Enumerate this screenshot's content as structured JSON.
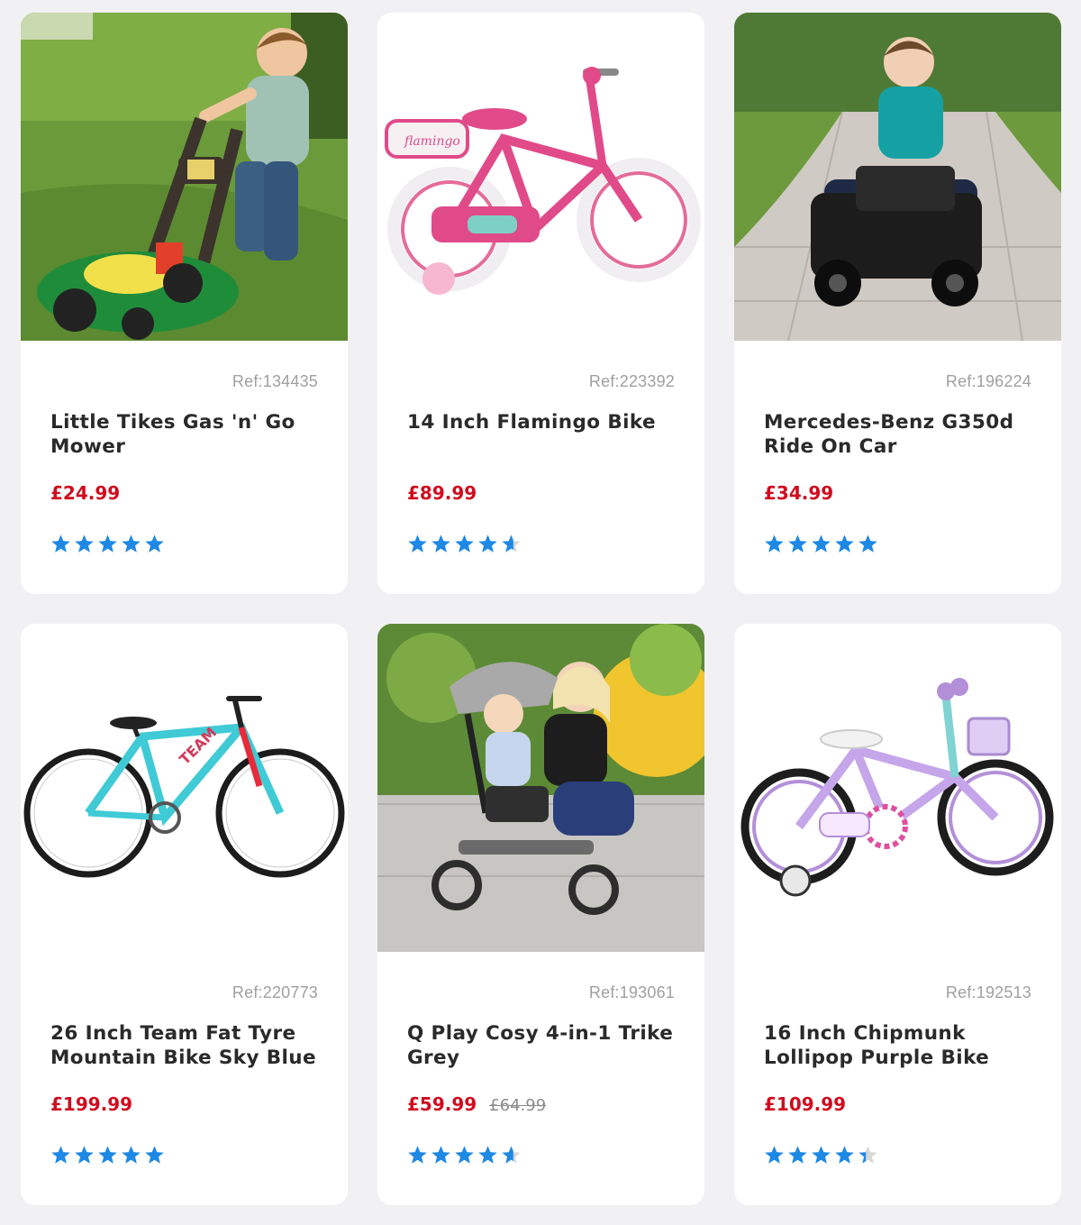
{
  "colors": {
    "page_background": "#f1f1f3",
    "card_background": "#ffffff",
    "price": "#d10b1f",
    "star": "#1e88e5",
    "star_empty": "#d6d6d6",
    "ref_text": "#a0a0a0",
    "title_text": "#2a2a2a"
  },
  "products": [
    {
      "image": "boy-with-toy-lawn-mower-photo",
      "ref": "Ref:134435",
      "title": "Little Tikes Gas 'n' Go Mower",
      "price": "£24.99",
      "old_price": "",
      "rating": 5
    },
    {
      "image": "pink-flamingo-kids-bike-photo",
      "ref": "Ref:223392",
      "title": "14 Inch Flamingo Bike",
      "price": "£89.99",
      "old_price": "",
      "rating": 4.6
    },
    {
      "image": "boy-on-black-ride-on-car-photo",
      "ref": "Ref:196224",
      "title": "Mercedes-Benz G350d Ride On Car",
      "price": "£34.99",
      "old_price": "",
      "rating": 5
    },
    {
      "image": "sky-blue-mountain-bike-photo",
      "ref": "Ref:220773",
      "title": "26 Inch Team Fat Tyre Mountain Bike Sky Blue",
      "price": "£199.99",
      "old_price": "",
      "rating": 5
    },
    {
      "image": "mother-and-baby-with-trike-photo",
      "ref": "Ref:193061",
      "title": "Q Play Cosy 4-in-1 Trike Grey",
      "price": "£59.99",
      "old_price": "£64.99",
      "rating": 4.6
    },
    {
      "image": "purple-chipmunk-kids-bike-photo",
      "ref": "Ref:192513",
      "title": "16 Inch Chipmunk Lollipop Purple Bike",
      "price": "£109.99",
      "old_price": "",
      "rating": 4.4
    }
  ]
}
